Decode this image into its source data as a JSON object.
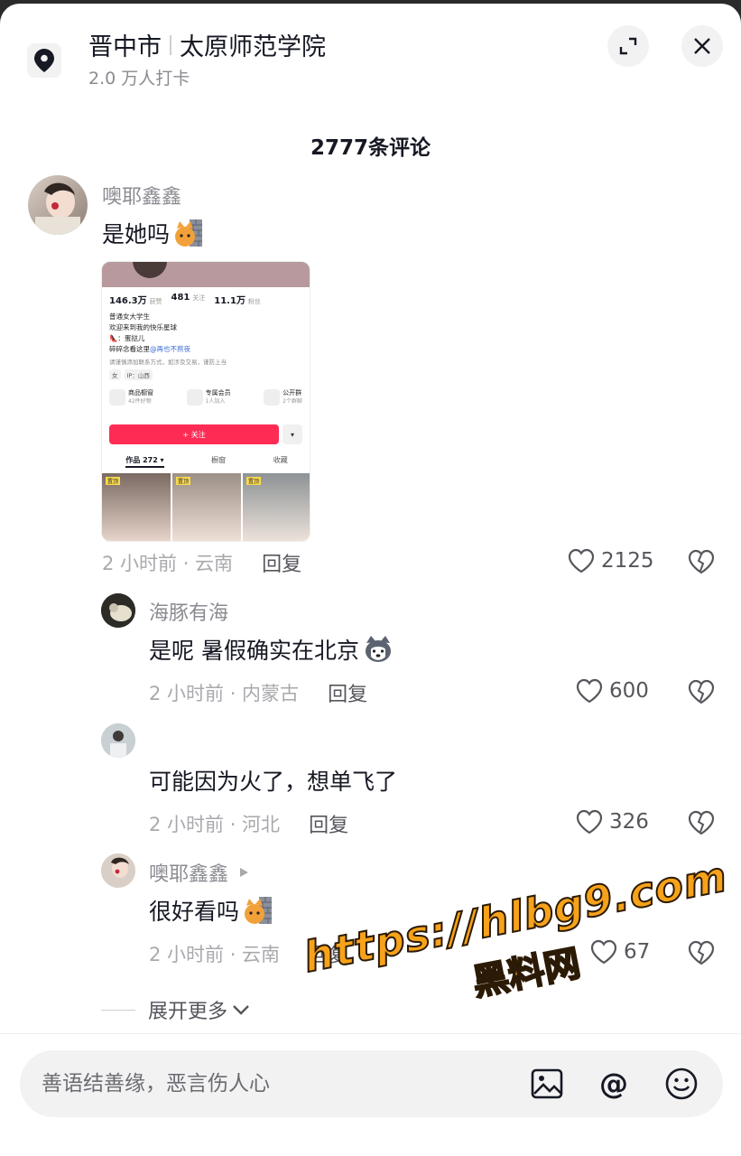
{
  "header": {
    "city": "晋中市",
    "place": "太原师范学院",
    "checkins": "2.0 万人打卡"
  },
  "comment_count": "2777条评论",
  "comments": [
    {
      "user": "噢耶鑫鑫",
      "text": "是她吗",
      "time_loc": "2 小时前 · 云南",
      "reply": "回复",
      "likes": "2125",
      "image": {
        "stats": [
          {
            "num": "146.3万",
            "label": "获赞"
          },
          {
            "num": "481",
            "label": "关注"
          },
          {
            "num": "11.1万",
            "label": "粉丝"
          }
        ],
        "bio": [
          "普通女大学生",
          "欢迎来到我的快乐星球",
          "👠：蛋挞儿",
          "碎碎念看这里"
        ],
        "bio_link": "@再也不熬夜",
        "note": "请谨慎添加联系方式，如涉及交易，谨防上当",
        "tags": [
          "女",
          "IP：山西"
        ],
        "features": [
          {
            "name": "商品橱窗",
            "sub": "42件好物"
          },
          {
            "name": "专属会员",
            "sub": "1人加入"
          },
          {
            "name": "公开群",
            "sub": "2个群聊"
          }
        ],
        "follow": "+ 关注",
        "tabs": [
          "作品 272 ▾",
          "橱窗",
          "收藏"
        ],
        "pin": "置顶"
      }
    },
    {
      "user": "海豚有海",
      "text": "是呢 暑假确实在北京",
      "time_loc": "2 小时前 · 内蒙古",
      "reply": "回复",
      "likes": "600"
    },
    {
      "user": "",
      "text": "可能因为火了，想单飞了",
      "time_loc": "2 小时前 · 河北",
      "reply": "回复",
      "likes": "326"
    },
    {
      "user": "噢耶鑫鑫",
      "text": "很好看吗",
      "time_loc": "2 小时前 · 云南",
      "reply": "回复",
      "likes": "67"
    }
  ],
  "expand": "展开更多",
  "input_placeholder": "善语结善缘，恶言伤人心",
  "at_symbol": "@",
  "watermark": {
    "url": "https://hlbg9.com",
    "name": "黑料网"
  }
}
